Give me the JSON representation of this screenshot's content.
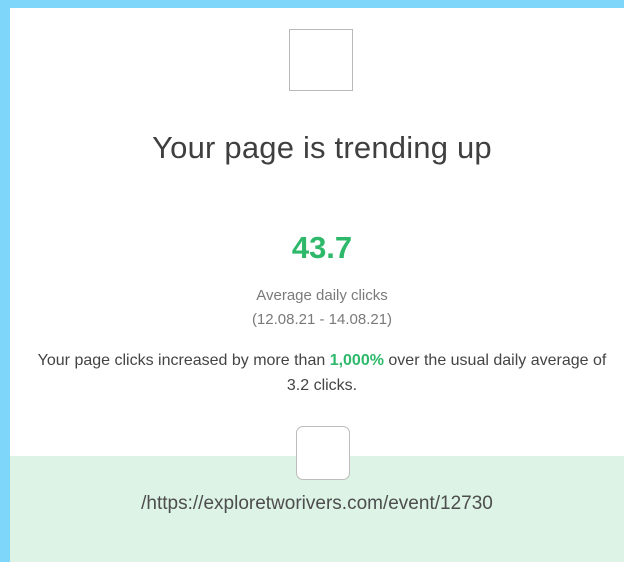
{
  "card": {
    "title": "Your page is trending up",
    "metric": {
      "value": "43.7",
      "label": "Average daily clicks",
      "date_range": "(12.08.21 - 14.08.21)"
    },
    "summary": {
      "prefix": "Your page clicks increased by more than ",
      "percent": "1,000%",
      "suffix": " over the usual daily average of 3.2 clicks."
    },
    "footer": {
      "url": "/https://exploretworivers.com/event/12730"
    }
  },
  "colors": {
    "background": "#7fd6fb",
    "card": "#ffffff",
    "accent": "#2eb86a",
    "footer_background": "#dcf3e6"
  }
}
